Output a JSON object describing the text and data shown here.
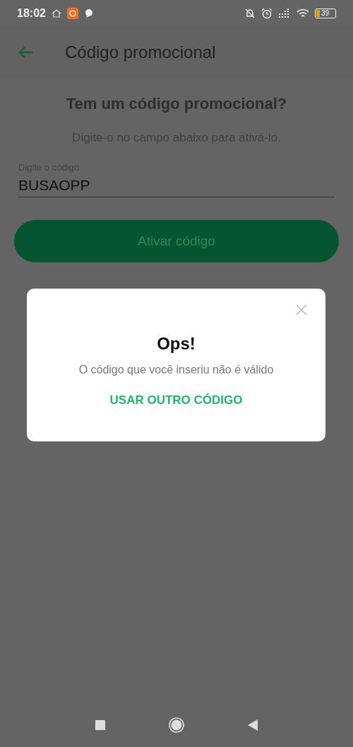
{
  "status_bar": {
    "time": "18:02",
    "battery": {
      "text": "39"
    }
  },
  "app_bar": {
    "title": "Código promocional"
  },
  "heading": "Tem um código promocional?",
  "subtitle": "Digite-o no campo abaixo para ativá-lo.",
  "code_field": {
    "label": "Digite o código",
    "value": "BUSAOPP"
  },
  "activate_button": {
    "label": "Ativar código",
    "disabled": true
  },
  "dialog": {
    "title": "Ops!",
    "message": "O código que você inseriu não é válido",
    "action": "USAR OUTRO CÓDIGO"
  }
}
